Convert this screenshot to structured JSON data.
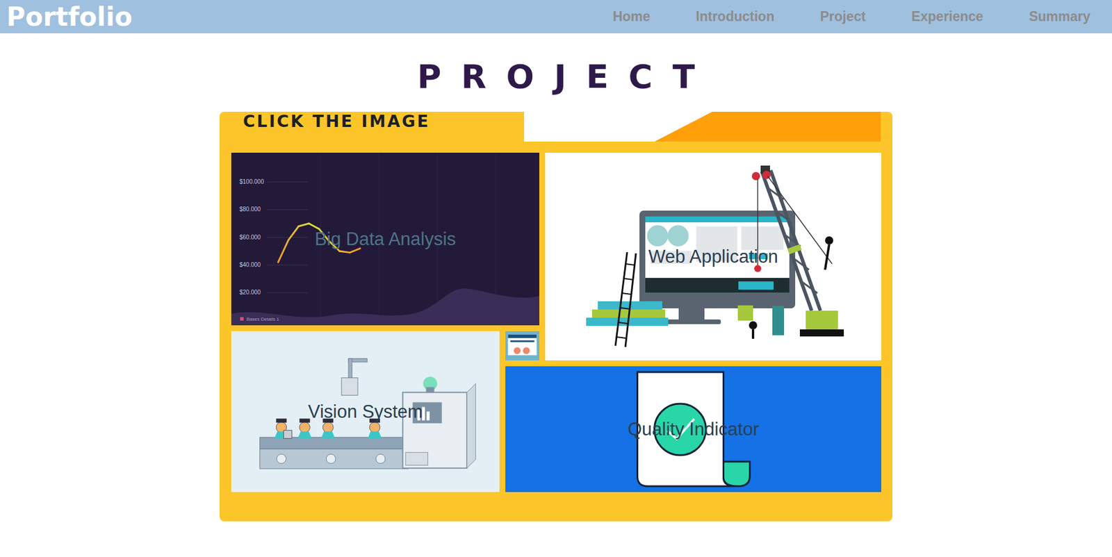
{
  "header": {
    "logo": "Portfolio",
    "nav": [
      "Home",
      "Introduction",
      "Project",
      "Experience",
      "Summary"
    ]
  },
  "title": "PROJECT",
  "panel": {
    "label": "CLICK THE IMAGE",
    "tiles": [
      {
        "kind": "chart",
        "label": "Big Data Analysis",
        "chart": {
          "ticks": [
            "$100.000",
            "$80.000",
            "$60.000",
            "$40.000",
            "$20.000"
          ],
          "legend": "Bases Details 1",
          "series": [
            42000,
            58000,
            68000,
            70000,
            66000,
            57000,
            50000,
            49000,
            52000
          ]
        }
      },
      {
        "kind": "web",
        "label": "Web Application"
      },
      {
        "kind": "vision",
        "label": "Vision System"
      },
      {
        "kind": "thumb",
        "label": ""
      },
      {
        "kind": "quality",
        "label": "Quality Indicator"
      }
    ]
  }
}
